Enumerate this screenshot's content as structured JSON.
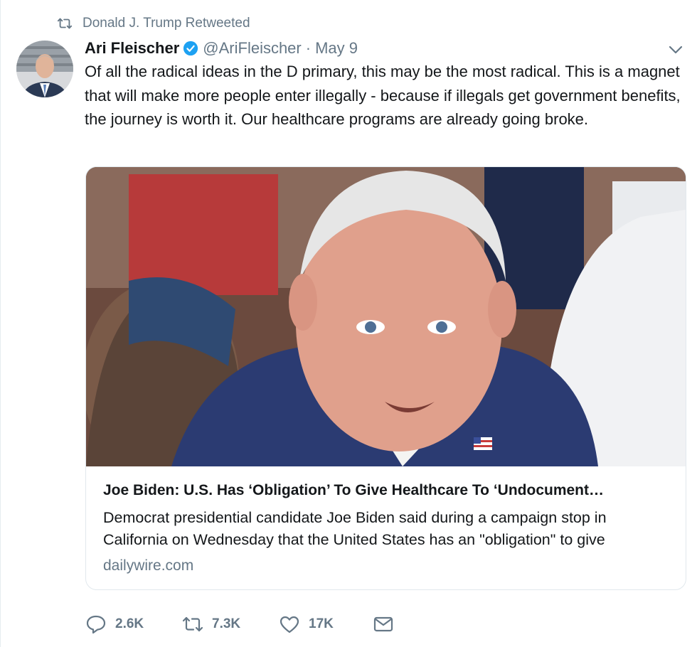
{
  "retweet_context": {
    "text": "Donald J. Trump Retweeted"
  },
  "author": {
    "display_name": "Ari Fleischer",
    "handle": "@AriFleischer",
    "date": "May 9"
  },
  "tweet": {
    "text": "Of all the radical ideas in the D primary, this may be the most radical. This is a magnet that will make more people enter illegally - because if illegals get government benefits, the journey is worth it. Our healthcare programs are already going broke."
  },
  "card": {
    "title": "Joe Biden: U.S. Has ‘Obligation’ To Give Healthcare To ‘Undocument…",
    "description": "Democrat presidential candidate Joe Biden said during a campaign stop in California on Wednesday that the United States has an \"obligation\" to give",
    "domain": "dailywire.com"
  },
  "actions": {
    "replies": "2.6K",
    "retweets": "7.3K",
    "likes": "17K"
  },
  "colors": {
    "text": "#14171a",
    "muted": "#657786",
    "verified": "#1da1f2",
    "border": "#e1e8ed"
  },
  "icons": [
    "retweet-icon",
    "verified-badge-icon",
    "chevron-down-icon",
    "reply-icon",
    "retweet-icon",
    "like-icon",
    "direct-message-icon"
  ]
}
